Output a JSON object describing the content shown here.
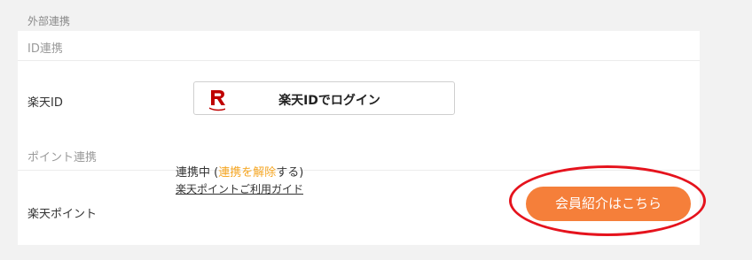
{
  "section": {
    "title": "外部連携"
  },
  "id_link": {
    "header": "ID連携",
    "rakuten_id": {
      "label": "楽天ID",
      "login_button": "楽天IDでログイン",
      "icon": "rakuten-r-logo",
      "brand_color": "#bf0000"
    }
  },
  "point_link": {
    "header": "ポイント連携",
    "rakuten_point": {
      "label": "楽天ポイント",
      "status_prefix": "連携中 (",
      "unlink_text": "連携を解除",
      "status_suffix": "する)",
      "guide_link": "楽天ポイントご利用ガイド",
      "member_button": "会員紹介はこちら",
      "member_button_color": "#f57f3a",
      "unlink_color": "#f5a623"
    }
  },
  "annotation": {
    "shape": "ellipse",
    "color": "#e5131d"
  }
}
